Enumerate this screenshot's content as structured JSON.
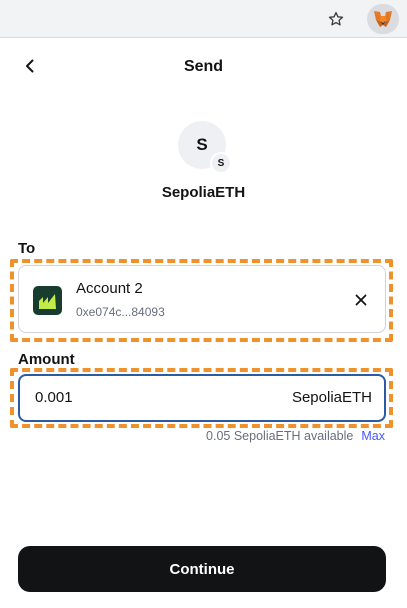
{
  "browser": {
    "bookmark_icon": "star-icon",
    "extension_icon": "metamask-fox-icon"
  },
  "header": {
    "back_icon": "chevron-left-icon",
    "title": "Send"
  },
  "asset": {
    "avatar_letter": "S",
    "network_letter": "S",
    "name": "SepoliaETH"
  },
  "recipient": {
    "section_label": "To",
    "account_name": "Account 2",
    "address": "0xe074c...84093",
    "clear_icon": "close-icon"
  },
  "amount": {
    "section_label": "Amount",
    "value": "0.001",
    "unit": "SepoliaETH",
    "available": "0.05 SepoliaETH available",
    "max_label": "Max"
  },
  "footer": {
    "continue_label": "Continue"
  },
  "colors": {
    "highlight": "#f0922b",
    "focus_border": "#2a5aa8",
    "link": "#4459ff",
    "primary_button": "#121314"
  }
}
